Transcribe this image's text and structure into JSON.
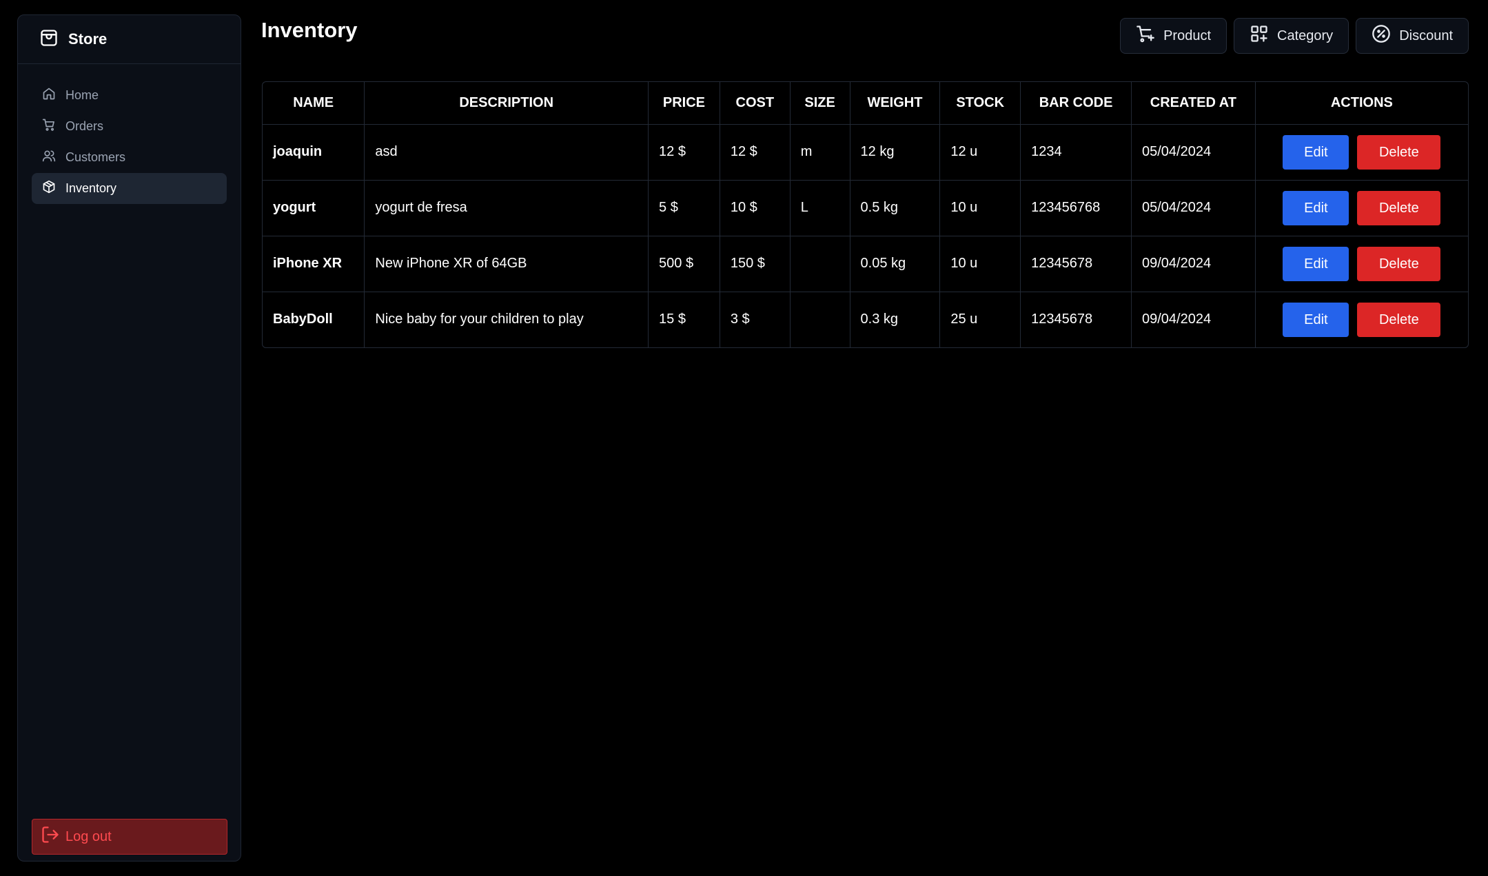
{
  "sidebar": {
    "brand": "Store",
    "items": [
      {
        "label": "Home",
        "icon": "home-icon"
      },
      {
        "label": "Orders",
        "icon": "cart-icon"
      },
      {
        "label": "Customers",
        "icon": "users-icon"
      },
      {
        "label": "Inventory",
        "icon": "package-icon",
        "active": true
      }
    ],
    "logout": "Log out"
  },
  "main": {
    "title": "Inventory",
    "toolbar": {
      "product": "Product",
      "category": "Category",
      "discount": "Discount"
    },
    "table": {
      "headers": [
        "NAME",
        "DESCRIPTION",
        "PRICE",
        "COST",
        "SIZE",
        "WEIGHT",
        "STOCK",
        "BAR CODE",
        "CREATED AT",
        "ACTIONS"
      ],
      "rows": [
        {
          "name": "joaquin",
          "description": "asd",
          "price": "12 $",
          "cost": "12 $",
          "size": "m",
          "weight": "12 kg",
          "stock": "12 u",
          "barcode": "1234",
          "created": "05/04/2024"
        },
        {
          "name": "yogurt",
          "description": "yogurt de fresa",
          "price": "5 $",
          "cost": "10 $",
          "size": "L",
          "weight": "0.5 kg",
          "stock": "10 u",
          "barcode": "123456768",
          "created": "05/04/2024"
        },
        {
          "name": "iPhone XR",
          "description": "New iPhone XR of 64GB",
          "price": "500 $",
          "cost": "150 $",
          "size": "",
          "weight": "0.05 kg",
          "stock": "10 u",
          "barcode": "12345678",
          "created": "09/04/2024"
        },
        {
          "name": "BabyDoll",
          "description": "Nice baby for your children to play",
          "price": "15 $",
          "cost": "3 $",
          "size": "",
          "weight": "0.3 kg",
          "stock": "25 u",
          "barcode": "12345678",
          "created": "09/04/2024"
        }
      ],
      "edit_label": "Edit",
      "delete_label": "Delete"
    }
  },
  "colors": {
    "background": "#000000",
    "sidebar": "#0b0f17",
    "edit": "#2563eb",
    "delete": "#dc2626",
    "logout_bg": "#6a1a1d",
    "logout_text": "#ff4a4f"
  }
}
